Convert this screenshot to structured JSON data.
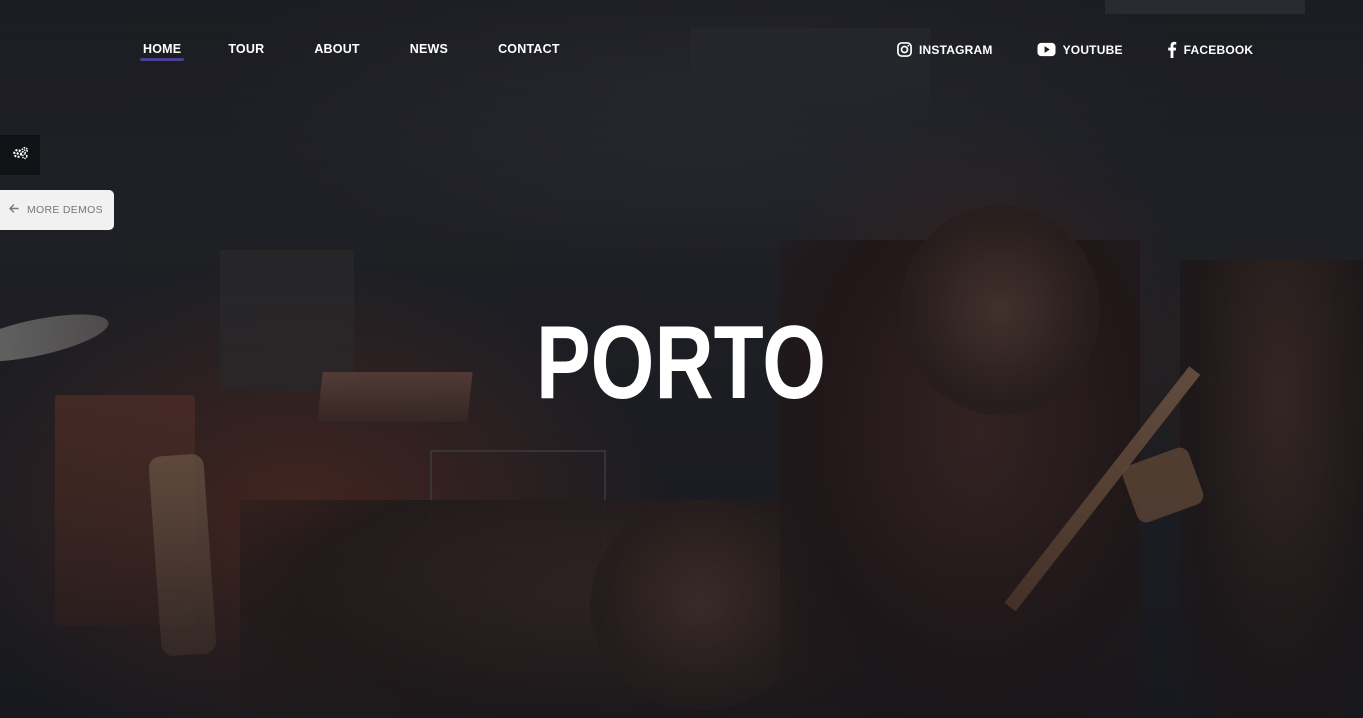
{
  "nav": {
    "items": [
      {
        "label": "HOME",
        "active": true
      },
      {
        "label": "TOUR"
      },
      {
        "label": "ABOUT"
      },
      {
        "label": "NEWS"
      },
      {
        "label": "CONTACT"
      }
    ],
    "active_underline_color": "#4b3f8f"
  },
  "social": {
    "instagram": {
      "label": "INSTAGRAM",
      "icon": "instagram-icon"
    },
    "youtube": {
      "label": "YOUTUBE",
      "icon": "youtube-icon"
    },
    "facebook": {
      "label": "FACEBOOK",
      "icon": "facebook-icon"
    }
  },
  "sidebar_widgets": {
    "settings_icon": "gears-icon",
    "demos_label": "MORE DEMOS",
    "demos_icon": "arrow-left-icon"
  },
  "logo": {
    "text": "PORTO"
  },
  "colors": {
    "background": "#1f2025",
    "text": "#ffffff",
    "settings_bg": "#111215",
    "demos_bg": "#f1f1f1"
  }
}
